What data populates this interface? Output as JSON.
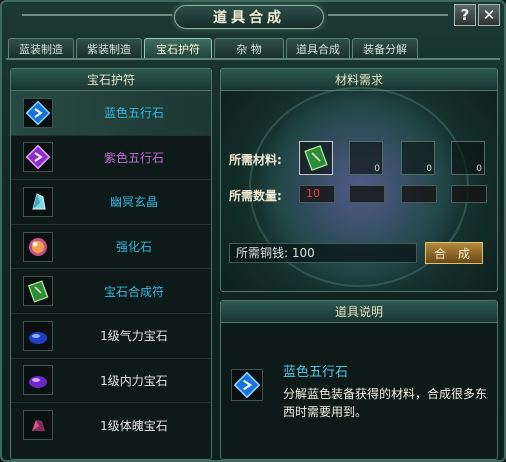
{
  "window": {
    "title": "道具合成",
    "help_label": "?",
    "close_label": "✕"
  },
  "tabs": [
    {
      "label": "蓝装制造"
    },
    {
      "label": "紫装制造"
    },
    {
      "label": "宝石护符",
      "active": true
    },
    {
      "label": "杂  物"
    },
    {
      "label": "道具合成"
    },
    {
      "label": "装备分解"
    }
  ],
  "left_panel": {
    "header": "宝石护符",
    "items": [
      {
        "label": "蓝色五行石",
        "icon": "blue-rune-stone-icon",
        "color": "#36b6e6",
        "selected": true
      },
      {
        "label": "紫色五行石",
        "icon": "purple-rune-stone-icon",
        "color": "#c46ad6"
      },
      {
        "label": "幽冥玄晶",
        "icon": "crystal-icon",
        "color": "#36b6e6"
      },
      {
        "label": "强化石",
        "icon": "orb-icon",
        "color": "#36b6e6"
      },
      {
        "label": "宝石合成符",
        "icon": "talisman-icon",
        "color": "#36b6e6"
      },
      {
        "label": "1级气力宝石",
        "icon": "blue-gem-icon",
        "color": "#e6e6e6"
      },
      {
        "label": "1级内力宝石",
        "icon": "purple-gem-icon",
        "color": "#e6e6e6"
      },
      {
        "label": "1级体魄宝石",
        "icon": "red-gem-icon",
        "color": "#e6e6e6"
      }
    ]
  },
  "materials": {
    "header": "材料需求",
    "required_material_label": "所需材料:",
    "required_qty_label": "所需数量:",
    "slots": [
      {
        "icon": "green-talisman-icon",
        "count": ""
      },
      {
        "icon": "",
        "count": "0"
      },
      {
        "icon": "",
        "count": "0"
      },
      {
        "icon": "",
        "count": "0"
      }
    ],
    "quantities": [
      "10",
      "",
      "",
      ""
    ],
    "copper_label": "所需铜钱: 100",
    "compose_button": "合 成"
  },
  "description": {
    "header": "道具说明",
    "item_name": "蓝色五行石",
    "item_icon": "blue-rune-stone-icon",
    "text": "分解蓝色装备获得的材料，合成很多东西时需要用到。"
  },
  "colors": {
    "accent": "#36b6e6",
    "purple": "#c46ad6",
    "qty_red": "#ff3b3b"
  }
}
